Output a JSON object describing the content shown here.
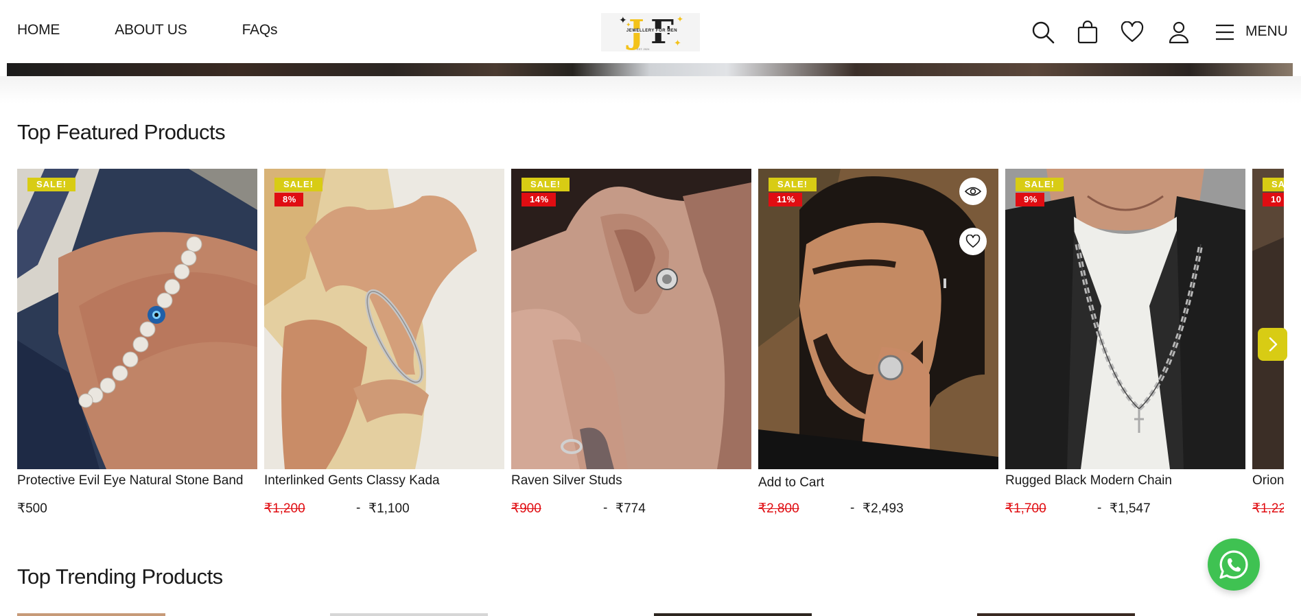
{
  "header": {
    "nav": [
      {
        "label": "HOME"
      },
      {
        "label": "ABOUT US"
      },
      {
        "label": "FAQs"
      }
    ],
    "logo": {
      "text": "JEWELLERY FOR MEN",
      "letters": [
        "J",
        "F"
      ],
      "sub": "EST. 2024"
    },
    "icons": [
      "search-icon",
      "cart-bag-icon",
      "wishlist-heart-icon",
      "account-user-icon",
      "hamburger-menu-icon"
    ],
    "menu_label": "MENU"
  },
  "sections": {
    "featured_title": "Top Featured Products",
    "trending_title": "Top Trending Products"
  },
  "featured_products": [
    {
      "name": "Protective Evil Eye Natural Stone Band",
      "price": "₹500",
      "sale": "SALE!"
    },
    {
      "name": "Interlinked Gents Classy Kada",
      "old_price": "₹1,200",
      "sep": "-",
      "price": "₹1,100",
      "sale": "SALE!",
      "discount": "8%"
    },
    {
      "name": "Raven Silver Studs",
      "old_price": "₹900",
      "sep": "-",
      "price": "₹774",
      "sale": "SALE!",
      "discount": "14%"
    },
    {
      "name": "Add to Cart",
      "old_price": "₹2,800",
      "sep": "-",
      "price": "₹2,493",
      "sale": "SALE!",
      "discount": "11%"
    },
    {
      "name": "Rugged Black Modern Chain",
      "old_price": "₹1,700",
      "sep": "-",
      "price": "₹1,547",
      "sale": "SALE!",
      "discount": "9%"
    },
    {
      "name": "Orion",
      "old_price": "₹1,22",
      "sale": "SA",
      "discount": "10"
    }
  ],
  "colors": {
    "sale_badge": "#d8cc14",
    "discount_badge": "#e00d12",
    "old_price": "#e00d12",
    "whatsapp": "#3fc252",
    "arrow": "#d8cc14"
  }
}
